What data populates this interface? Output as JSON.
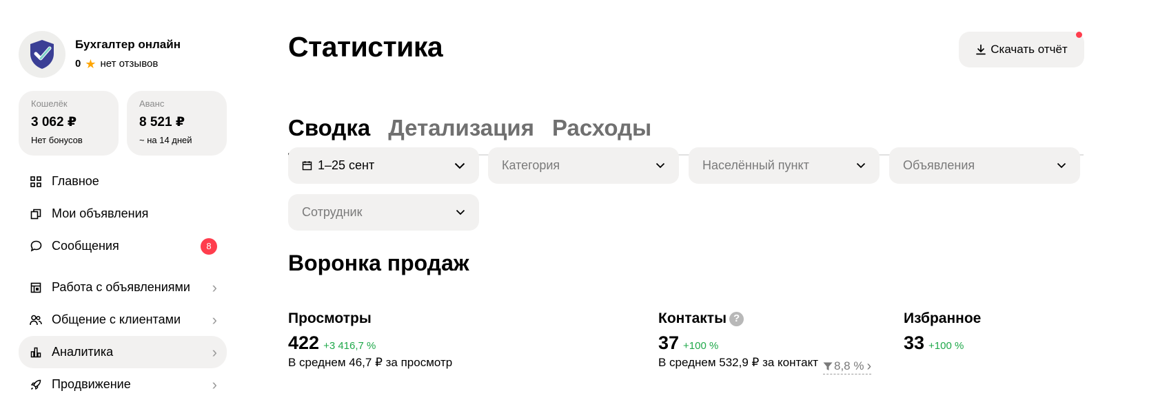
{
  "profile": {
    "name": "Бухгалтер онлайн",
    "rating_value": "0",
    "rating_text": "нет отзывов"
  },
  "wallet": {
    "label": "Кошелёк",
    "value": "3 062 ₽",
    "sub": "Нет бонусов"
  },
  "advance": {
    "label": "Аванс",
    "value": "8 521 ₽",
    "sub": "~ на 14 дней"
  },
  "nav": {
    "items": [
      {
        "label": "Главное",
        "icon": "grid-icon"
      },
      {
        "label": "Мои объявления",
        "icon": "copy-icon"
      },
      {
        "label": "Сообщения",
        "icon": "chat-bubble-icon",
        "badge": "8"
      },
      {
        "label": "Работа с объявлениями",
        "icon": "listing-work-icon"
      },
      {
        "label": "Общение с клиентами",
        "icon": "people-icon"
      },
      {
        "label": "Аналитика",
        "icon": "bar-chart-icon"
      },
      {
        "label": "Продвижение",
        "icon": "rocket-icon"
      }
    ]
  },
  "page": {
    "title": "Статистика",
    "download_label": "Скачать отчёт"
  },
  "tabs": [
    "Сводка",
    "Детализация",
    "Расходы"
  ],
  "filters": {
    "period": "1–25 сент",
    "category": "Категория",
    "location": "Населённый пункт",
    "ads": "Объявления",
    "employee": "Сотрудник"
  },
  "funnel": {
    "title": "Воронка продаж",
    "views": {
      "title": "Просмотры",
      "value": "422",
      "delta": "+3 416,7 %",
      "sub": "В среднем 46,7 ₽ за просмотр"
    },
    "conversion": "8,8 %",
    "contacts": {
      "title": "Контакты",
      "value": "37",
      "delta": "+100 %",
      "sub": "В среднем 532,9 ₽ за контакт"
    },
    "favorites": {
      "title": "Избранное",
      "value": "33",
      "delta": "+100 %"
    }
  },
  "colors": {
    "accent_red": "#ff3d4d",
    "positive_green": "#1fa84a",
    "surface": "#f2f1f0"
  }
}
